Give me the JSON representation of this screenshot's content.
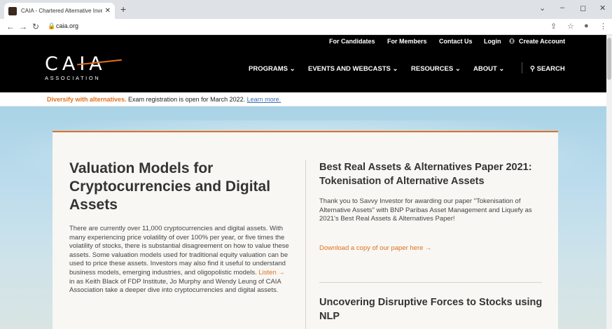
{
  "browser": {
    "tab_title": "CAIA - Chartered Alternative Inve",
    "tab_close": "✕",
    "new_tab": "+",
    "url": "caia.org",
    "win_min": "–",
    "win_max": "◻",
    "win_close": "✕"
  },
  "utility_nav": [
    "For Candidates",
    "For Members",
    "Contact Us",
    "Login",
    "Create Account"
  ],
  "logo": {
    "mark": "CAIA",
    "sub": "ASSOCIATION"
  },
  "main_nav": [
    "PROGRAMS ⌄",
    "EVENTS AND WEBCASTS ⌄",
    "RESOURCES ⌄",
    "ABOUT ⌄"
  ],
  "search_label": "SEARCH",
  "announcement": {
    "highlight": "Diversify with alternatives.",
    "text": " Exam registration is open for March 2022. ",
    "link": "Learn more."
  },
  "feature": {
    "title": "Valuation Models for Cryptocurrencies and Digital Assets",
    "body_before": "There are currently over 11,000 cryptocurrencies and digital assets. With many experiencing price volatility of over 100% per year, or five times the volatility of stocks, there is substantial disagreement on how to value these assets. Some valuation models used for traditional equity valuation can be used to price these assets. Investors may also find it useful to understand business models, emerging industries, and oligopolistic models. ",
    "body_link": "Listen →",
    "body_after": " in as Keith Black of FDP Institute, Jo Murphy and Wendy Leung of CAIA Association take a deeper dive into cryptocurrencies and digital assets."
  },
  "side_1": {
    "title": "Best Real Assets & Alternatives Paper 2021: Tokenisation of Alternative Assets",
    "body": "Thank you to Savvy Investor for awarding our paper \"Tokenisation of Alternative Assets\" with BNP Paribas Asset Management and Liquefy as 2021's Best Real Assets & Alternatives Paper!",
    "link": "Download a copy of our paper here →"
  },
  "side_2": {
    "title": "Uncovering Disruptive Forces to Stocks using NLP"
  },
  "colors": {
    "accent": "#e0701f",
    "header_bg": "#000000",
    "link_blue": "#3a6fb0"
  }
}
